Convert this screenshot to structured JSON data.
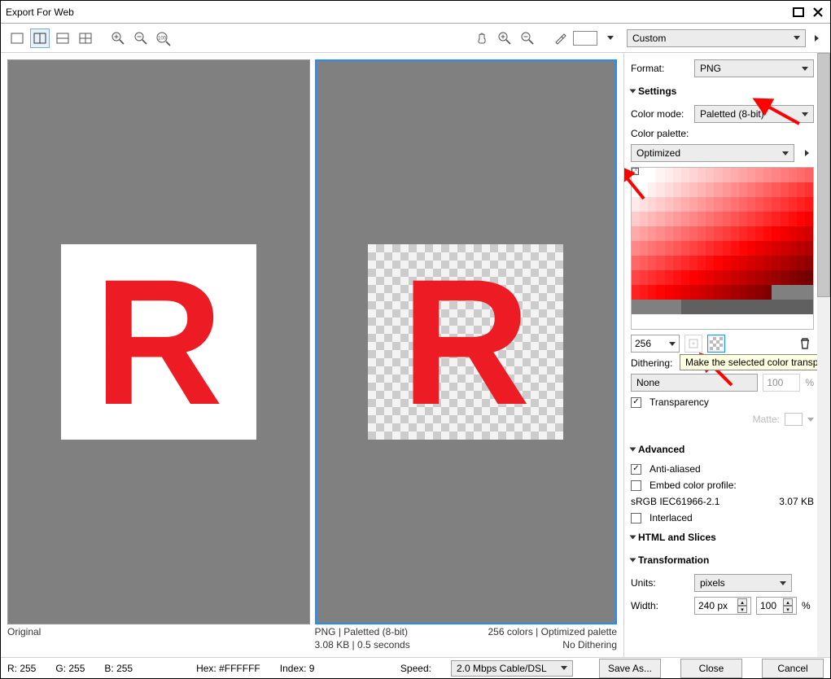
{
  "window": {
    "title": "Export For Web"
  },
  "toolbar": {
    "preset": "Custom"
  },
  "preview": {
    "original_label": "Original",
    "opt_line1_left": "PNG  |  Paletted (8-bit)",
    "opt_line2_left": "3.08 KB  |  0.5 seconds",
    "opt_line1_right": "256 colors  |  Optimized palette",
    "opt_line2_right": "No Dithering",
    "letter": "R"
  },
  "side": {
    "format_label": "Format:",
    "format_value": "PNG",
    "section_settings": "Settings",
    "color_mode_label": "Color mode:",
    "color_mode_value": "Paletted (8-bit)",
    "color_palette_label": "Color palette:",
    "color_palette_value": "Optimized",
    "num_colors": "256",
    "tooltip": "Make the selected color transparent",
    "dithering_label": "Dithering:",
    "dithering_value": "None",
    "dither_amount": "100",
    "pct": "%",
    "transparency": "Transparency",
    "matte_label": "Matte:",
    "section_advanced": "Advanced",
    "anti_aliased": "Anti-aliased",
    "embed_profile": "Embed color profile:",
    "profile_name": "sRGB IEC61966-2.1",
    "profile_size": "3.07 KB",
    "interlaced": "Interlaced",
    "section_html": "HTML and Slices",
    "section_transform": "Transformation",
    "units_label": "Units:",
    "units_value": "pixels",
    "width_label": "Width:",
    "width_value": "240 px",
    "width_pct": "100"
  },
  "status": {
    "r": "R: 255",
    "g": "G: 255",
    "b": "B: 255",
    "hex": "Hex: #FFFFFF",
    "index": "Index: 9",
    "speed_label": "Speed:",
    "speed_value": "2.0 Mbps Cable/DSL"
  },
  "buttons": {
    "save": "Save As...",
    "close": "Close",
    "cancel": "Cancel"
  },
  "palette_colors": [
    [
      "#ffffff",
      "#ffffff",
      "#ffffff",
      "#fff4f4",
      "#ffecec",
      "#ffe4e4",
      "#ffdcdc",
      "#ffd4d4",
      "#ffcccc",
      "#ffc4c4",
      "#ffbcbc",
      "#ffb4b4",
      "#ffacac",
      "#ffa4a4",
      "#ff9c9c",
      "#ff9494",
      "#ff8c8c",
      "#ff8484",
      "#ff7c7c",
      "#ff7474",
      "#ff6c6c",
      "#ff6464"
    ],
    [
      "#ffffff",
      "#ffffff",
      "#fff0f0",
      "#ffe6e6",
      "#ffdcdc",
      "#ffd2d2",
      "#ffc8c8",
      "#ffbebe",
      "#ffb4b4",
      "#ffaaaa",
      "#ffa0a0",
      "#ff9696",
      "#ff8c8c",
      "#ff8282",
      "#ff7878",
      "#ff6e6e",
      "#ff6464",
      "#ff5a5a",
      "#ff5050",
      "#ff4646",
      "#ff3c3c",
      "#ff3232"
    ],
    [
      "#ffeaea",
      "#ffe0e0",
      "#ffd6d6",
      "#ffcccc",
      "#ffc2c2",
      "#ffb8b8",
      "#ffaeae",
      "#ffa4a4",
      "#ff9a9a",
      "#ff9090",
      "#ff8686",
      "#ff7c7c",
      "#ff7272",
      "#ff6868",
      "#ff5e5e",
      "#ff5454",
      "#ff4a4a",
      "#ff4040",
      "#ff3636",
      "#ff2c2c",
      "#ff2222",
      "#ff1818"
    ],
    [
      "#ffcccc",
      "#ffc2c2",
      "#ffb8b8",
      "#ffaeae",
      "#ffa4a4",
      "#ff9a9a",
      "#ff9090",
      "#ff8686",
      "#ff7c7c",
      "#ff7272",
      "#ff6868",
      "#ff5e5e",
      "#ff5454",
      "#ff4a4a",
      "#ff4040",
      "#ff3636",
      "#ff2c2c",
      "#ff2222",
      "#ff1818",
      "#ff0e0e",
      "#ff0404",
      "#f50000"
    ],
    [
      "#ffaaaa",
      "#ffa0a0",
      "#ff9696",
      "#ff8c8c",
      "#ff8282",
      "#ff7878",
      "#ff6e6e",
      "#ff6464",
      "#ff5a5a",
      "#ff5050",
      "#ff4646",
      "#ff3c3c",
      "#ff3232",
      "#ff2828",
      "#ff1e1e",
      "#ff1414",
      "#ff0a0a",
      "#fb0000",
      "#f10000",
      "#e70000",
      "#dd0000",
      "#d30000"
    ],
    [
      "#ff8888",
      "#ff7e7e",
      "#ff7474",
      "#ff6a6a",
      "#ff6060",
      "#ff5656",
      "#ff4c4c",
      "#ff4242",
      "#ff3838",
      "#ff2e2e",
      "#ff2424",
      "#ff1a1a",
      "#ff1010",
      "#ff0606",
      "#f60000",
      "#ec0000",
      "#e20000",
      "#d80000",
      "#ce0000",
      "#c40000",
      "#ba0000",
      "#b00000"
    ],
    [
      "#ff6666",
      "#ff5c5c",
      "#ff5252",
      "#ff4848",
      "#ff3e3e",
      "#ff3434",
      "#ff2a2a",
      "#ff2020",
      "#ff1616",
      "#ff0c0c",
      "#ff0202",
      "#f50000",
      "#eb0000",
      "#e10000",
      "#d70000",
      "#cd0000",
      "#c30000",
      "#b90000",
      "#af0000",
      "#a50000",
      "#9b0000",
      "#910000"
    ],
    [
      "#ff4444",
      "#ff3a3a",
      "#ff3030",
      "#ff2626",
      "#ff1c1c",
      "#ff1212",
      "#ff0808",
      "#fd0000",
      "#f30000",
      "#e90000",
      "#df0000",
      "#d50000",
      "#cb0000",
      "#c10000",
      "#b70000",
      "#ad0000",
      "#a30000",
      "#990000",
      "#8f0000",
      "#850000",
      "#7b0000",
      "#710000"
    ],
    [
      "#ff2222",
      "#ff1818",
      "#ff0e0e",
      "#ff0404",
      "#f80000",
      "#ee0000",
      "#e40000",
      "#da0000",
      "#d00000",
      "#c60000",
      "#bc0000",
      "#b20000",
      "#a80000",
      "#9e0000",
      "#940000",
      "#8a0000",
      "#800000",
      "#808080",
      "#808080",
      "#808080",
      "#808080",
      "#808080"
    ],
    [
      "#808080",
      "#808080",
      "#808080",
      "#808080",
      "#808080",
      "#808080",
      "#606060",
      "#606060",
      "#606060",
      "#606060",
      "#606060",
      "#606060",
      "#606060",
      "#606060",
      "#606060",
      "#606060",
      "#606060",
      "#606060",
      "#606060",
      "#606060",
      "#606060",
      "#606060"
    ],
    [
      "#ffffff",
      "#ffffff",
      "#ffffff",
      "#ffffff",
      "#ffffff",
      "#ffffff",
      "#ffffff",
      "#ffffff",
      "#ffffff",
      "#ffffff",
      "#ffffff",
      "#ffffff",
      "#ffffff",
      "#ffffff",
      "#ffffff",
      "#ffffff",
      "#ffffff",
      "#ffffff",
      "#ffffff",
      "#ffffff",
      "#ffffff",
      "#ffffff"
    ]
  ]
}
